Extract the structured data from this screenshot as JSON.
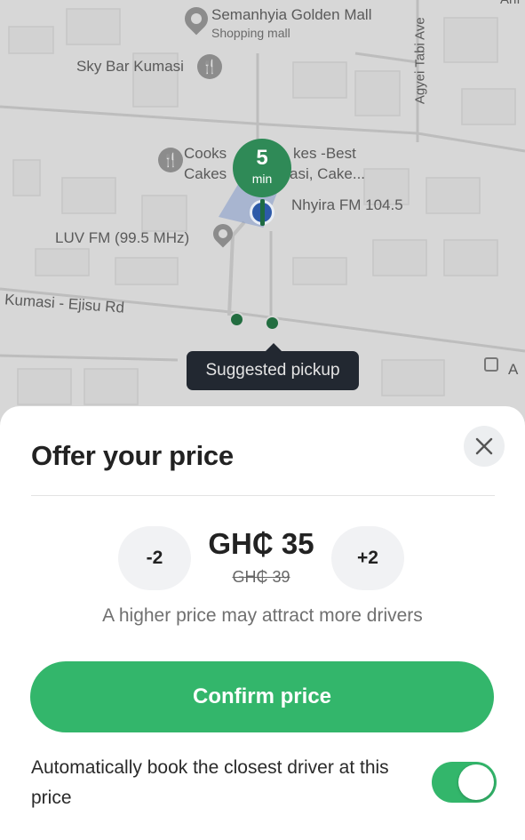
{
  "map": {
    "labels": {
      "mall_name": "Semanhyia Golden Mall",
      "mall_type": "Shopping mall",
      "sky_bar": "Sky Bar Kumasi",
      "cooks_line1": "Cooks",
      "cooks_line2": "Cakes",
      "cakes_line1": "kes -Best",
      "cakes_line2": "asi, Cake...",
      "nhyira": "Nhyira FM 104.5",
      "luv_fm": "LUV FM (99.5 MHz)",
      "road": "Kumasi - Ejisu Rd",
      "avenue": "Agyei Tabi Ave",
      "edge_a": "A",
      "top_right": "Anı"
    },
    "eta": {
      "value": "5",
      "unit": "min"
    },
    "pickup_tooltip": "Suggested pickup"
  },
  "sheet": {
    "title": "Offer your price",
    "price": {
      "decrement_label": "-2",
      "increment_label": "+2",
      "current": "GH₵ 35",
      "previous": "GH₵ 39",
      "hint": "A higher price may attract more drivers"
    },
    "confirm_label": "Confirm price",
    "auto_book": {
      "text": "Automatically book the closest driver at this price",
      "enabled": true
    }
  },
  "colors": {
    "accent": "#33b66b",
    "eta_badge": "#2f8a57",
    "tooltip_bg": "#222831"
  }
}
